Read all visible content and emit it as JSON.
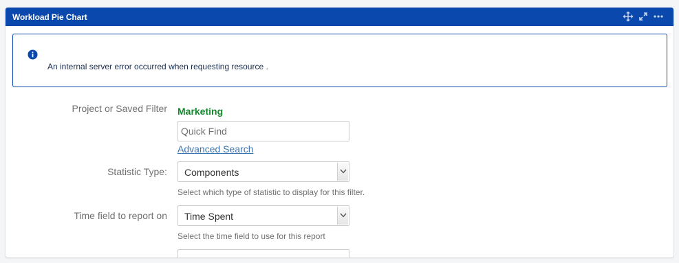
{
  "gadget": {
    "title": "Workload Pie Chart",
    "header_icons": [
      "move-icon",
      "expand-icon",
      "more-options-icon"
    ]
  },
  "message": {
    "icon": "info-icon",
    "text": "An internal server error occurred when requesting resource ."
  },
  "form": {
    "project_filter": {
      "label": "Project or Saved Filter",
      "selected": "Marketing",
      "quick_find_placeholder": "Quick Find",
      "quick_find_value": "",
      "advanced_search_link": "Advanced Search"
    },
    "statistic_type": {
      "label": "Statistic Type:",
      "value": "Components",
      "description": "Select which type of statistic to display for this filter."
    },
    "time_field": {
      "label": "Time field to report on",
      "value": "Time Spent",
      "description": "Select the time field to use for this report"
    }
  },
  "colors": {
    "header_bg": "#0a48ad",
    "filter_green": "#14892c",
    "link_blue": "#3b73af",
    "label_gray": "#707070"
  }
}
